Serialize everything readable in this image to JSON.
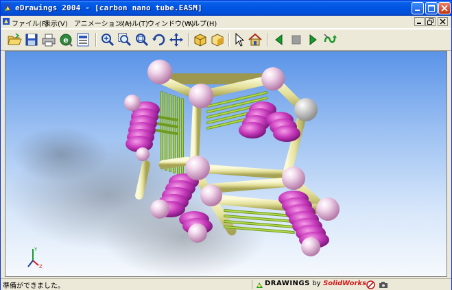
{
  "window": {
    "title": "eDrawings 2004 - [carbon nano tube.EASM]"
  },
  "titlebar_buttons": [
    "minimize-icon",
    "maximize-icon",
    "close-icon"
  ],
  "menu": {
    "items": [
      {
        "label": "ファイル(F)"
      },
      {
        "label": "表示(V)"
      },
      {
        "label": "アニメーション(A)"
      },
      {
        "label": "ツール(T)"
      },
      {
        "label": "ウィンドウ(W)"
      },
      {
        "label": "ヘルプ(H)"
      }
    ]
  },
  "toolbar": {
    "tools": [
      "open-icon",
      "save-icon",
      "print-icon",
      "send-email-icon",
      "page-setup-icon",
      "zoom-icon",
      "zoom-to-area-icon",
      "zoom-to-fit-icon",
      "rotate-icon",
      "pan-icon",
      "shaded-view-icon",
      "transparent-view-icon",
      "select-icon",
      "home-icon",
      "previous-icon",
      "stop-icon",
      "play-icon",
      "continuous-play-icon"
    ]
  },
  "viewport": {
    "model": "carbon nano tube assembly",
    "triad_labels": {
      "y": "Y",
      "z": "Z"
    },
    "colors": {
      "sphere": "#eccde6",
      "tube": "#e9e7a8",
      "ring": "#c03cb8",
      "rod": "#8db32c"
    }
  },
  "status": {
    "text": "準備ができました。",
    "brand_prefix": "DRAWINGS",
    "brand_by": "by",
    "brand_name": "SolidWorks"
  }
}
